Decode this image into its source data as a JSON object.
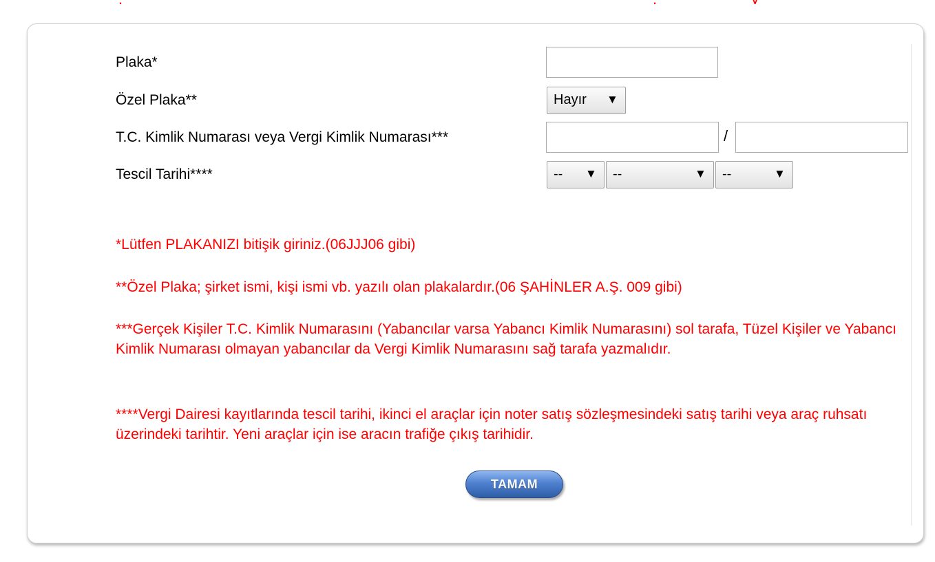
{
  "form": {
    "plaka_label": "Plaka*",
    "plaka_value": "",
    "ozel_plaka_label": "Özel Plaka**",
    "ozel_plaka_selected": "Hayır",
    "kimlik_label": "T.C. Kimlik Numarası veya Vergi Kimlik Numarası***",
    "tc_kimlik_value": "",
    "separator": "/",
    "vergi_kimlik_value": "",
    "tescil_label": "Tescil Tarihi****",
    "tescil_day_selected": "--",
    "tescil_month_selected": "--",
    "tescil_year_selected": "--"
  },
  "notes": {
    "note1": "*Lütfen PLAKANIZI bitişik giriniz.(06JJJ06 gibi)",
    "note2": "**Özel Plaka; şirket ismi, kişi ismi vb. yazılı olan plakalardır.(06 ŞAHİNLER A.Ş. 009 gibi)",
    "note3": "***Gerçek Kişiler T.C. Kimlik Numarasını (Yabancılar varsa Yabancı Kimlik Numarasını) sol tarafa, Tüzel Kişiler ve Yabancı Kimlik Numarası olmayan yabancılar da Vergi Kimlik Numarasını sağ tarafa yazmalıdır.",
    "note4": "****Vergi Dairesi kayıtlarında tescil tarihi, ikinci el araçlar için noter satış sözleşmesindeki satış tarihi veya araç ruhsatı üzerindeki tarihtir. Yeni araçlar için ise aracın trafiğe çıkış tarihidir."
  },
  "actions": {
    "submit_label": "TAMAM"
  },
  "colors": {
    "note_red": "#ff0000",
    "button_blue": "#4f81cf"
  },
  "icons": {
    "dropdown": "down-triangle"
  }
}
